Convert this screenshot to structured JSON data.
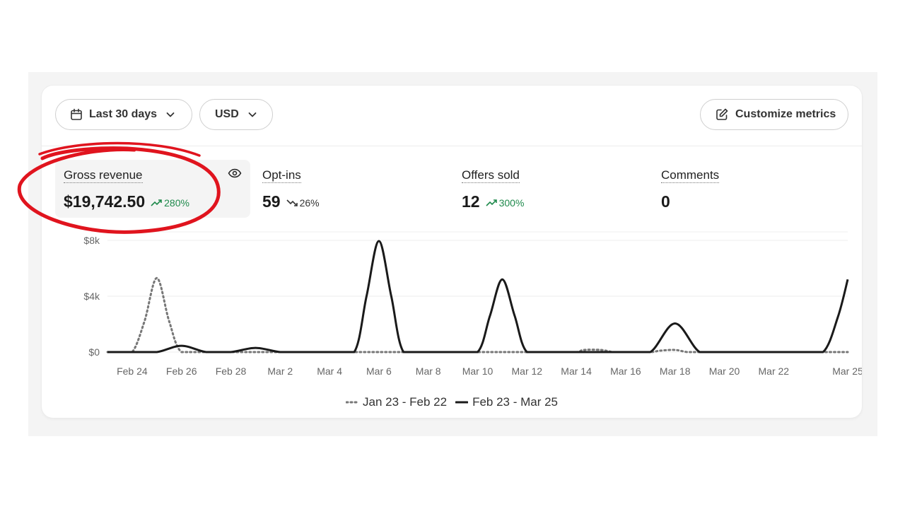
{
  "toolbar": {
    "date_range_label": "Last 30 days",
    "currency_label": "USD",
    "customize_label": "Customize metrics"
  },
  "metrics": [
    {
      "label": "Gross revenue",
      "value": "$19,742.50",
      "delta": "280%",
      "trend": "up",
      "selected": true
    },
    {
      "label": "Opt-ins",
      "value": "59",
      "delta": "26%",
      "trend": "down",
      "selected": false
    },
    {
      "label": "Offers sold",
      "value": "12",
      "delta": "300%",
      "trend": "up",
      "selected": false
    },
    {
      "label": "Comments",
      "value": "0",
      "delta": "",
      "trend": "none",
      "selected": false
    }
  ],
  "colors": {
    "up": "#1f8a4c",
    "current_series": "#1a1a1a",
    "previous_series": "#777777",
    "annotation": "#e0141e"
  },
  "chart_data": {
    "type": "line",
    "y_ticks": [
      "$0",
      "$4k",
      "$8k"
    ],
    "y_tick_values": [
      0,
      4000,
      8000
    ],
    "ylim": [
      0,
      8200
    ],
    "x_tick_labels": [
      "Feb 24",
      "Feb 26",
      "Feb 28",
      "Mar 2",
      "Mar 4",
      "Mar 6",
      "Mar 8",
      "Mar 10",
      "Mar 12",
      "Mar 14",
      "Mar 16",
      "Mar 18",
      "Mar 20",
      "Mar 22",
      "Mar 25"
    ],
    "x_tick_days": [
      1,
      3,
      5,
      7,
      9,
      11,
      13,
      15,
      17,
      19,
      21,
      23,
      25,
      27,
      30
    ],
    "grid": true,
    "legend_position": "bottom",
    "series": [
      {
        "name": "Jan 23 - Feb 22",
        "style": "dotted",
        "points": [
          [
            0,
            0
          ],
          [
            0.4,
            0
          ],
          [
            1.0,
            0
          ],
          [
            1.5,
            2200
          ],
          [
            2.0,
            5300
          ],
          [
            2.5,
            2200
          ],
          [
            3.0,
            0
          ],
          [
            4,
            0
          ],
          [
            5,
            0
          ],
          [
            6,
            0
          ],
          [
            7,
            0
          ],
          [
            8,
            0
          ],
          [
            9,
            0
          ],
          [
            10,
            0
          ],
          [
            11,
            0
          ],
          [
            12,
            0
          ],
          [
            13,
            0
          ],
          [
            14,
            0
          ],
          [
            15,
            0
          ],
          [
            16,
            0
          ],
          [
            17,
            0
          ],
          [
            18,
            0
          ],
          [
            19,
            0
          ],
          [
            19.3,
            150
          ],
          [
            20,
            150
          ],
          [
            20.5,
            0
          ],
          [
            21,
            0
          ],
          [
            22,
            0
          ],
          [
            22.4,
            100
          ],
          [
            23,
            150
          ],
          [
            23.5,
            0
          ],
          [
            24,
            0
          ],
          [
            25,
            0
          ],
          [
            26,
            0
          ],
          [
            27,
            0
          ],
          [
            28,
            0
          ],
          [
            29,
            0
          ],
          [
            30,
            0
          ]
        ]
      },
      {
        "name": "Feb 23 - Mar 25",
        "style": "solid",
        "points": [
          [
            0,
            0
          ],
          [
            1,
            0
          ],
          [
            2,
            0
          ],
          [
            3,
            450
          ],
          [
            4,
            0
          ],
          [
            5,
            0
          ],
          [
            6,
            300
          ],
          [
            7,
            0
          ],
          [
            8,
            0
          ],
          [
            9,
            0
          ],
          [
            10,
            0
          ],
          [
            10.5,
            4000
          ],
          [
            11,
            7950
          ],
          [
            11.5,
            4000
          ],
          [
            12,
            0
          ],
          [
            13,
            0
          ],
          [
            14,
            0
          ],
          [
            15,
            0
          ],
          [
            15.5,
            2600
          ],
          [
            16,
            5200
          ],
          [
            16.5,
            2600
          ],
          [
            17,
            0
          ],
          [
            18,
            0
          ],
          [
            19,
            0
          ],
          [
            20,
            0
          ],
          [
            21,
            0
          ],
          [
            22,
            0
          ],
          [
            23,
            2050
          ],
          [
            24,
            0
          ],
          [
            25,
            0
          ],
          [
            26,
            0
          ],
          [
            27,
            0
          ],
          [
            28,
            0
          ],
          [
            29,
            0
          ],
          [
            29.6,
            2500
          ],
          [
            30,
            5200
          ]
        ]
      }
    ]
  }
}
